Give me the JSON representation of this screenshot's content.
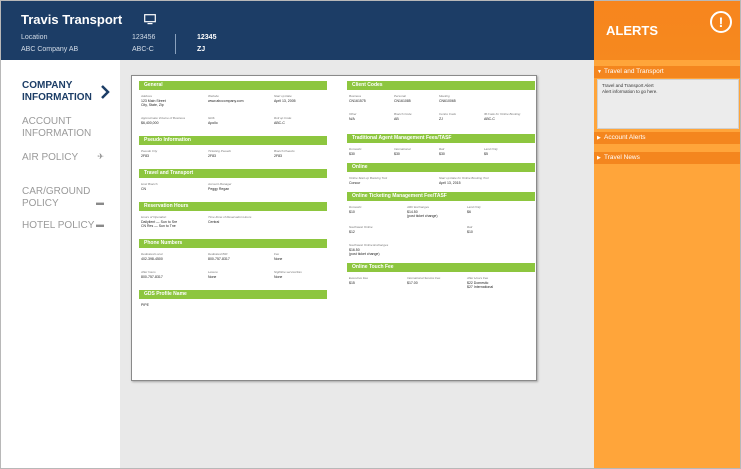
{
  "header": {
    "brand": "Travis Transport",
    "location_label": "Location",
    "location_value": "ABC Company  AB",
    "account_number": "123456",
    "account_code": "ABC-C",
    "highlight_number": "12345",
    "highlight_code": "ZJ"
  },
  "sidebar": {
    "items": [
      {
        "label": "COMPANY INFORMATION",
        "active": true,
        "icon": "chevron-right-icon"
      },
      {
        "label": "ACCOUNT INFORMATION",
        "active": false
      },
      {
        "label": "AIR POLICY",
        "active": false,
        "icon": "airplane-icon",
        "glyph": "✈"
      },
      {
        "label": "CAR/GROUND POLICY",
        "active": false,
        "icon": "car-icon",
        "glyph": "▬"
      },
      {
        "label": "HOTEL POLICY",
        "active": false,
        "icon": "bed-icon",
        "glyph": "▬"
      }
    ]
  },
  "document": {
    "left": {
      "general": {
        "title": "General",
        "address_label": "Address",
        "address_1": "123 Main Street",
        "address_2": "City, State, Zip",
        "website_label": "Website",
        "website": "www.abccompany.com",
        "startup_label": "Start up Date",
        "startup": "April 13, 2005",
        "volume_label": "Approximate Volume of Business",
        "volume": "$6,400,000",
        "gds_label": "GDS",
        "gds": "Apollo",
        "rollup_label": "Roll up Code",
        "rollup": "ABC-C"
      },
      "pseudo": {
        "title": "Pseudo Information",
        "pc_label": "Pseudo City",
        "pc": "2F83",
        "tp_label": "Ticketing Pseudo",
        "tp": "2F83",
        "bp_label": "Branch Pseudo",
        "bp": "2F83"
      },
      "travel": {
        "title": "Travel and Transport",
        "branch_label": "Host Branch",
        "branch": "CN",
        "manager_label": "Account Manager",
        "manager": "Peggy Regan"
      },
      "hours": {
        "title": "Reservation Hours",
        "hours_label": "Hours of Operation",
        "hours_1": "Dailylient — Sun to Sre",
        "hours_2": "CN Res — Sun to Tne",
        "tz_label": "Time Zone of Reservation Hours",
        "tz": "Central"
      },
      "phones": {
        "title": "Phone Numbers",
        "dl_label": "Dedicated Local",
        "dl": "402-398-4500",
        "d8_label": "Dedicated 800",
        "d8": "800-757-8317",
        "fax_label": "Fax",
        "fax": "None",
        "ah_label": "After hours",
        "ah": "800-757-8317",
        "leisure_label": "Leisure",
        "leisure": "None",
        "night_label": "Nightline service/Fax",
        "night": "None"
      },
      "gds_profile": {
        "title": "GDS Profile Name",
        "value": "PIPE"
      }
    },
    "right": {
      "client": {
        "title": "Client Codes",
        "business_label": "Business",
        "business": "CN161575",
        "personal_label": "Personal",
        "personal": "CN161085",
        "meeting_label": "Meeting",
        "meeting": "CN610065",
        "other_label": "Other",
        "other": "N/A",
        "branch_label": "Branch Code",
        "branch": "AB",
        "centre_label": "Centre Code",
        "centre": "ZJ",
        "ib_label": "IB Code for Online Booking",
        "ib": "ABC-C"
      },
      "agent_fees": {
        "title": "Traditional Agent Management Fees/TASF",
        "domestic_label": "Domestic",
        "domestic": "$30",
        "intl_label": "International",
        "intl": "$30",
        "rail_label": "Rail",
        "rail": "$30",
        "land_label": "Land Only",
        "land": "$5"
      },
      "online": {
        "title": "Online",
        "tool_label": "Online Start up Booking Tool",
        "tool": "Concur",
        "date_label": "Start up Date for Online Booking Tool",
        "date": "April 13, 2015"
      },
      "online_fee": {
        "title": "Online Ticketing Management Fee/TASF",
        "domestic_label": "Domestic",
        "domestic": "$10",
        "arc_label": "ARC Exchanges",
        "arc": "$14.50",
        "arc_note": "(post ticket change)",
        "land_label": "Land Only",
        "land": "$6",
        "sw_label": "Southwest Online",
        "sw": "$12",
        "rail_label": "Rail",
        "rail": "$10",
        "swx_label": "Southwest Online Exchanges",
        "swx": "$16.50",
        "swx_note": "(post ticket change)"
      },
      "touch": {
        "title": "Online Touch Fee",
        "exec_label": "Executive Fee",
        "exec": "$15",
        "intl_label": "International Service Fee",
        "intl": "$17.00",
        "ah_label": "After Hours Fee",
        "ah_1": "$22 Domestic",
        "ah_2": "$27 International"
      }
    }
  },
  "alerts": {
    "title": "ALERTS",
    "icon": "exclamation-icon",
    "sections": [
      {
        "label": "Travel and Transport",
        "expanded": true,
        "body_1": "Travel and Transport Alert",
        "body_2": "Alert information to go here."
      },
      {
        "label": "Account Alerts",
        "expanded": false
      },
      {
        "label": "Travel News",
        "expanded": false
      }
    ]
  }
}
